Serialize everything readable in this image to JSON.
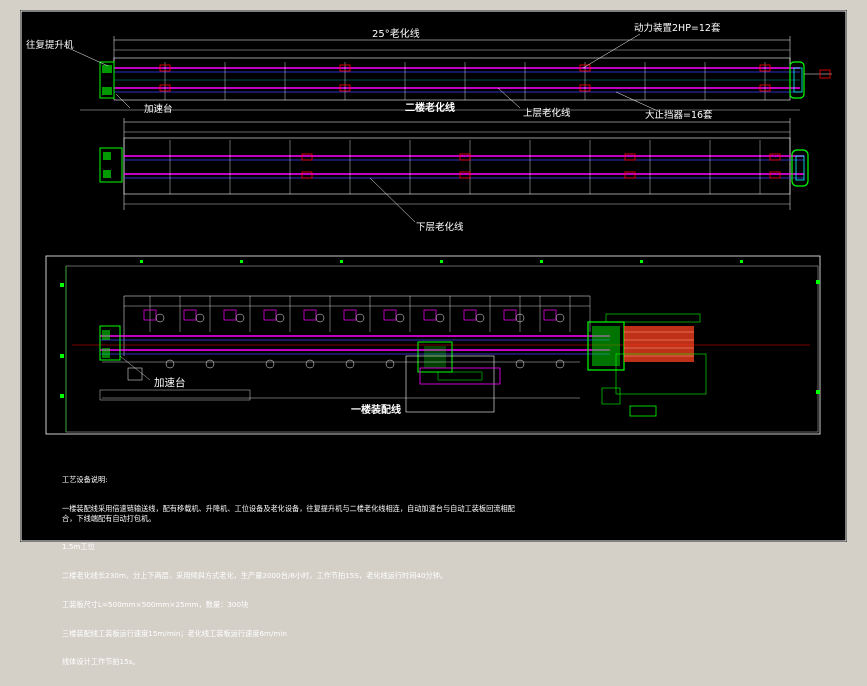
{
  "labels": {
    "title_top": "25°老化线",
    "hoist": "往复提升机",
    "power_unit": "动力装置2HP=12套",
    "accel_table_1": "加速台",
    "line_2": "二楼老化线",
    "upper_line": "上层老化线",
    "stopper": "大止挡器=16套",
    "lower_line": "下层老化线",
    "accel_table_2": "加速台",
    "line_1": "一楼装配线"
  },
  "notes": [
    "工艺设备说明:",
    "一楼装配线采用倍速链输送线，配有移载机、升降机、工位设备及老化设备，往复提升机与二楼老化线相连，自动加速台与自动工装板回流相配合，下线端配有自动打包机。",
    "1.5m工位",
    "二楼老化线长230m，分上下两层，采用倾斜方式老化，生产量2000台/8小时，工作节拍15S，老化线运行时间40分钟。",
    "工装板尺寸L=500mm×500mm×25mm，数量：300块",
    "三楼装配线工装板运行速度15m/min；老化线工装板运行速度6m/min",
    "线体设计工作节拍15s。"
  ],
  "colors": {
    "background": "#000000",
    "frame": "#ffffff",
    "conveyor": "#ff00ff",
    "equipment": "#00ff00",
    "marker": "#ff0000",
    "accent_cyan": "#00ffff",
    "blue_line": "#4040ff"
  }
}
